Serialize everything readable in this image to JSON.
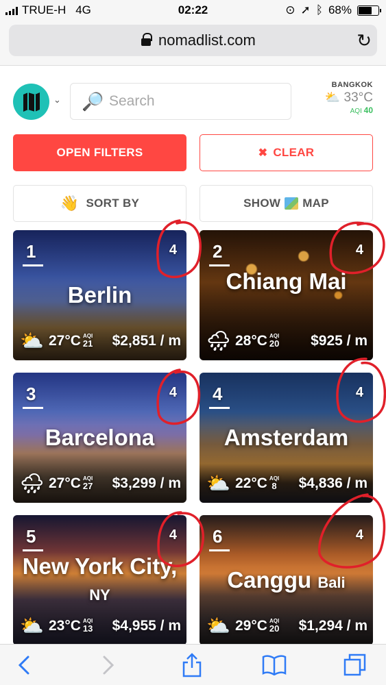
{
  "status": {
    "carrier": "TRUE-H",
    "network": "4G",
    "time": "02:22",
    "battery": "68%",
    "battery_level": 0.68
  },
  "browser": {
    "url": "nomadlist.com"
  },
  "header": {
    "search_placeholder": "Search",
    "weather": {
      "city": "BANGKOK",
      "temp": "33°C",
      "aqi_label": "AQI",
      "aqi_value": "40"
    }
  },
  "buttons": {
    "open_filters": "OPEN FILTERS",
    "clear": "CLEAR",
    "sort_by": "SORT BY",
    "show": "SHOW",
    "map": "MAP"
  },
  "cities": [
    {
      "rank": "1",
      "score": "4",
      "name": "Berlin",
      "suffix": "",
      "temp": "27°C",
      "aqi_label": "AQI",
      "aqi": "21",
      "cost": "$2,851 / m",
      "weather_icon": "partly-cloudy-icon"
    },
    {
      "rank": "2",
      "score": "4",
      "name": "Chiang Mai",
      "suffix": "",
      "temp": "28°C",
      "aqi_label": "AQI",
      "aqi": "20",
      "cost": "$925 / m",
      "weather_icon": "rain-icon"
    },
    {
      "rank": "3",
      "score": "4",
      "name": "Barcelona",
      "suffix": "",
      "temp": "27°C",
      "aqi_label": "AQI",
      "aqi": "27",
      "cost": "$3,299 / m",
      "weather_icon": "rain-icon"
    },
    {
      "rank": "4",
      "score": "4",
      "name": "Amsterdam",
      "suffix": "",
      "temp": "22°C",
      "aqi_label": "AQI",
      "aqi": "8",
      "cost": "$4,836 / m",
      "weather_icon": "partly-cloudy-icon"
    },
    {
      "rank": "5",
      "score": "4",
      "name": "New York City,",
      "suffix": "NY",
      "temp": "23°C",
      "aqi_label": "AQI",
      "aqi": "13",
      "cost": "$4,955 / m",
      "weather_icon": "partly-cloudy-icon"
    },
    {
      "rank": "6",
      "score": "4",
      "name": "Canggu",
      "suffix": "Bali",
      "temp": "29°C",
      "aqi_label": "AQI",
      "aqi": "20",
      "cost": "$1,294 / m",
      "weather_icon": "partly-cloudy-icon"
    }
  ],
  "colors": {
    "accent": "#ff4742",
    "logo": "#1fc1b6",
    "aqi_good": "#3bbf5f",
    "annotation": "#e0202a",
    "toolbar_icon": "#2f7bf6"
  }
}
